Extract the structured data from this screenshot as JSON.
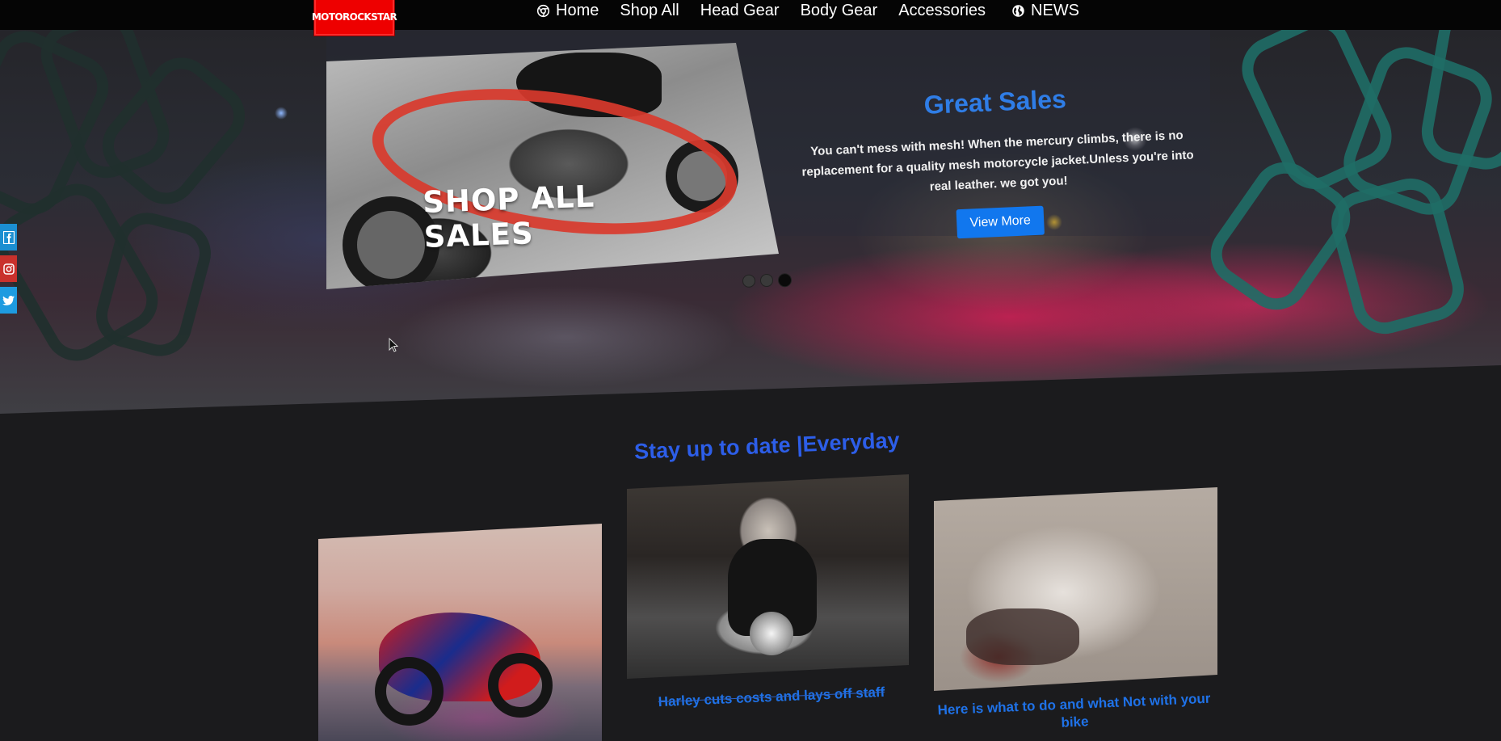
{
  "navbar": {
    "logo_text": "MOTOROCKSTAR",
    "items": [
      {
        "label": "Home",
        "icon": "chrome-icon"
      },
      {
        "label": "Shop All"
      },
      {
        "label": "Head Gear"
      },
      {
        "label": "Body Gear"
      },
      {
        "label": "Accessories"
      },
      {
        "label": "NEWS",
        "icon": "globe-icon"
      }
    ]
  },
  "hero": {
    "promo_text": "SHOP ALL SALES",
    "title": "Great Sales",
    "text": "You can't mess with mesh! When the mercury climbs, there is no replacement for a quality mesh motorcycle jacket.Unless you're into real leather. we got you!",
    "button_label": "View More",
    "slide_count": 3,
    "active_slide": 3
  },
  "social": [
    {
      "icon": "facebook-icon"
    },
    {
      "icon": "instagram-icon"
    },
    {
      "icon": "twitter-icon"
    }
  ],
  "news": {
    "title": "Stay up to date |Everyday",
    "cards": [
      {
        "caption": ""
      },
      {
        "caption": "Harley cuts costs and lays off staff"
      },
      {
        "caption": "Here is what to do and what Not  with your bike"
      }
    ]
  },
  "colors": {
    "accent_blue": "#2f7de6",
    "logo_red": "#ee0000",
    "button_blue": "#1177ee",
    "background": "#1b1b1d"
  }
}
